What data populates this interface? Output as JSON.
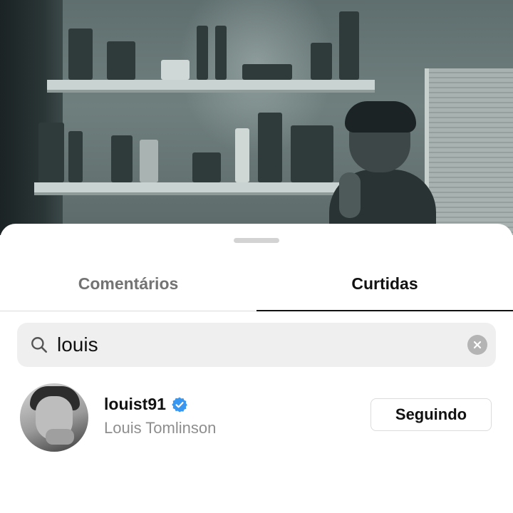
{
  "sheet": {
    "tabs": [
      {
        "label": "Comentários",
        "active": false
      },
      {
        "label": "Curtidas",
        "active": true
      }
    ],
    "search": {
      "value": "louis",
      "icon": "search-icon",
      "clear_icon": "clear-icon"
    },
    "results": [
      {
        "username": "louist91",
        "verified": true,
        "full_name": "Louis Tomlinson",
        "follow_label": "Seguindo"
      }
    ]
  },
  "colors": {
    "tab_active": "#111111",
    "tab_inactive": "#737373",
    "search_bg": "#efefef",
    "verified_blue": "#3897f0",
    "secondary_text": "#8e8e8e"
  }
}
